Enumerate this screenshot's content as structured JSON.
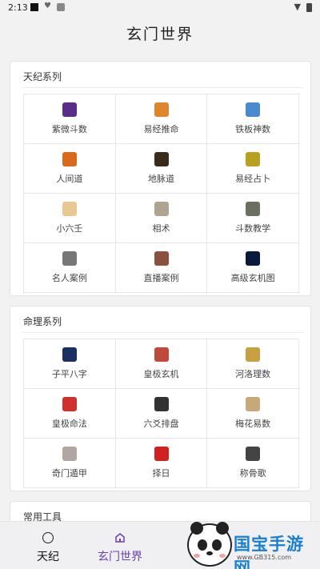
{
  "status_bar": {
    "time": "2:13"
  },
  "app_title": "玄门世界",
  "sections": [
    {
      "title": "天纪系列",
      "items": [
        {
          "label": "紫微斗数",
          "icon": "ziwei-icon",
          "color": "#5a2d8a"
        },
        {
          "label": "易经推命",
          "icon": "yijing-taiji-icon",
          "color": "#e0862a"
        },
        {
          "label": "铁板神数",
          "icon": "tieban-icon",
          "color": "#4a8ad0"
        },
        {
          "label": "人间道",
          "icon": "renjian-icon",
          "color": "#d96a1c"
        },
        {
          "label": "地脉道",
          "icon": "dimai-icon",
          "color": "#3a2a1a"
        },
        {
          "label": "易经占卜",
          "icon": "zhanbu-icon",
          "color": "#b8a020"
        },
        {
          "label": "小六壬",
          "icon": "liuren-icon",
          "color": "#e8c890"
        },
        {
          "label": "相术",
          "icon": "xiangshu-icon",
          "color": "#b0a490"
        },
        {
          "label": "斗数教学",
          "icon": "teaching-icon",
          "color": "#6a7060"
        },
        {
          "label": "名人案例",
          "icon": "celebrity-icon",
          "color": "#777777"
        },
        {
          "label": "直播案例",
          "icon": "live-icon",
          "color": "#8a5040"
        },
        {
          "label": "高级玄机图",
          "icon": "xuanji-icon",
          "color": "#0a1a3a"
        }
      ]
    },
    {
      "title": "命理系列",
      "items": [
        {
          "label": "子平八字",
          "icon": "bazi-icon",
          "color": "#1a3060"
        },
        {
          "label": "皇极玄机",
          "icon": "huangji-icon",
          "color": "#c04a3a"
        },
        {
          "label": "河洛理数",
          "icon": "heluo-icon",
          "color": "#c8a040"
        },
        {
          "label": "皇极命法",
          "icon": "mingfa-icon",
          "color": "#d03030"
        },
        {
          "label": "六爻排盘",
          "icon": "yinyang-icon",
          "color": "#333333"
        },
        {
          "label": "梅花易数",
          "icon": "meihua-icon",
          "color": "#c8a878"
        },
        {
          "label": "奇门遁甲",
          "icon": "qimen-icon",
          "color": "#b0a8a0"
        },
        {
          "label": "择日",
          "icon": "zeri-icon",
          "color": "#d02020"
        },
        {
          "label": "称骨歌",
          "icon": "chenggu-icon",
          "color": "#444444"
        }
      ]
    },
    {
      "title": "常用工具"
    }
  ],
  "tabs": [
    {
      "label": "天纪",
      "icon": "circle-icon"
    },
    {
      "label": "玄门世界",
      "icon": "home-icon"
    }
  ],
  "watermark": {
    "text": "国宝手游网",
    "url": "www.GB315.com"
  }
}
